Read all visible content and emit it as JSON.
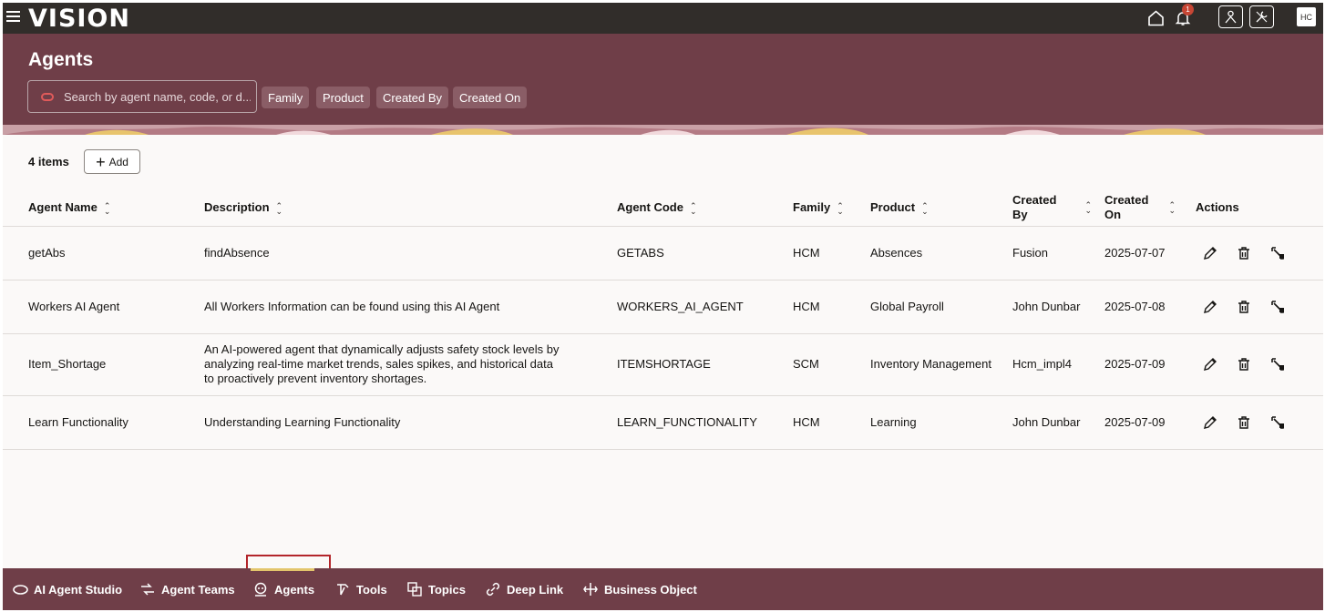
{
  "app": {
    "logo": "VISION",
    "notification_count": "1",
    "avatar_initials": "HC"
  },
  "header": {
    "title": "Agents",
    "search_placeholder": "Search by agent name, code, or d...",
    "filters": [
      "Family",
      "Product",
      "Created By",
      "Created On"
    ]
  },
  "toolbar": {
    "count_label": "4 items",
    "add_label": "Add"
  },
  "table": {
    "columns": [
      "Agent Name",
      "Description",
      "Agent Code",
      "Family",
      "Product",
      "Created By",
      "Created On",
      "Actions"
    ],
    "rows": [
      {
        "name": "getAbs",
        "description": "findAbsence",
        "code": "GETABS",
        "family": "HCM",
        "product": "Absences",
        "created_by": "Fusion",
        "created_on": "2025-07-07"
      },
      {
        "name": "Workers AI Agent",
        "description": "All Workers Information can be found using this AI Agent",
        "code": "WORKERS_AI_AGENT",
        "family": "HCM",
        "product": "Global Payroll",
        "created_by": "John Dunbar",
        "created_on": "2025-07-08"
      },
      {
        "name": "Item_Shortage",
        "description": "An AI-powered agent that dynamically adjusts safety stock levels by analyzing real-time market trends, sales spikes, and historical data to proactively prevent inventory shortages.",
        "code": "ITEMSHORTAGE",
        "family": "SCM",
        "product": "Inventory Management",
        "created_by": "Hcm_impl4",
        "created_on": "2025-07-09"
      },
      {
        "name": "Learn Functionality",
        "description": "Understanding Learning Functionality",
        "code": "LEARN_FUNCTIONALITY",
        "family": "HCM",
        "product": "Learning",
        "created_by": "John Dunbar",
        "created_on": "2025-07-09"
      }
    ]
  },
  "bottom_nav": {
    "items": [
      {
        "label": "AI Agent Studio",
        "icon": "oval-icon"
      },
      {
        "label": "Agent Teams",
        "icon": "team-flow-icon"
      },
      {
        "label": "Agents",
        "icon": "agent-icon"
      },
      {
        "label": "Tools",
        "icon": "tools-icon"
      },
      {
        "label": "Topics",
        "icon": "topics-icon"
      },
      {
        "label": "Deep Link",
        "icon": "link-icon"
      },
      {
        "label": "Business Object",
        "icon": "business-object-icon"
      }
    ],
    "selected": "Agents"
  },
  "colors": {
    "topbar": "#312d2a",
    "band": "#6f3e48",
    "accent_bar": "#e3c56c",
    "highlight_box": "#b3262b"
  }
}
